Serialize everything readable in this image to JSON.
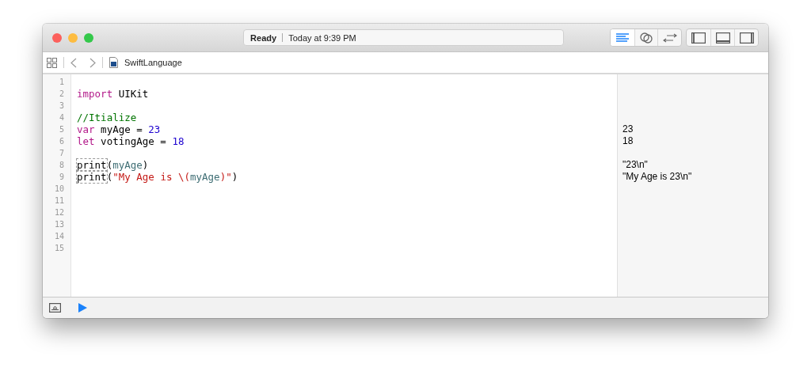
{
  "window": {
    "status": {
      "state": "Ready",
      "time": "Today at 9:39 PM"
    }
  },
  "toolbar": {
    "editor_buttons": [
      {
        "kind": "standard",
        "selected": true
      },
      {
        "kind": "assistant",
        "selected": false
      },
      {
        "kind": "version",
        "selected": false
      }
    ],
    "panel_buttons": [
      {
        "kind": "left",
        "selected": false
      },
      {
        "kind": "bottom",
        "selected": false
      },
      {
        "kind": "right",
        "selected": false
      }
    ]
  },
  "jump_bar": {
    "file": "SwiftLanguage"
  },
  "editor": {
    "lines": [
      {
        "number": "1"
      },
      {
        "number": "2",
        "tokens": [
          {
            "kind": "keyword",
            "text": "import"
          },
          {
            "kind": "plain",
            "text": " UIKit"
          }
        ]
      },
      {
        "number": "3"
      },
      {
        "number": "4",
        "tokens": [
          {
            "kind": "comment",
            "text": "//Itialize"
          }
        ]
      },
      {
        "number": "5",
        "tokens": [
          {
            "kind": "keyword",
            "text": "var"
          },
          {
            "kind": "plain",
            "text": " myAge = "
          },
          {
            "kind": "number",
            "text": "23"
          }
        ],
        "result": "23"
      },
      {
        "number": "6",
        "tokens": [
          {
            "kind": "keyword",
            "text": "let"
          },
          {
            "kind": "plain",
            "text": " votingAge = "
          },
          {
            "kind": "number",
            "text": "18"
          }
        ],
        "result": "18"
      },
      {
        "number": "7"
      },
      {
        "number": "8",
        "tokens": [
          {
            "kind": "marked",
            "text": "print"
          },
          {
            "kind": "plain",
            "text": "("
          },
          {
            "kind": "ident",
            "text": "myAge"
          },
          {
            "kind": "plain",
            "text": ")"
          }
        ],
        "result": "\"23\\n\""
      },
      {
        "number": "9",
        "tokens": [
          {
            "kind": "marked",
            "text": "print"
          },
          {
            "kind": "plain",
            "text": "("
          },
          {
            "kind": "string",
            "text": "\"My Age is \\("
          },
          {
            "kind": "ident",
            "text": "myAge"
          },
          {
            "kind": "string",
            "text": ")\""
          },
          {
            "kind": "plain",
            "text": ")"
          }
        ],
        "result": "\"My Age is 23\\n\""
      },
      {
        "number": "10"
      },
      {
        "number": "11"
      },
      {
        "number": "12"
      },
      {
        "number": "13"
      },
      {
        "number": "14"
      },
      {
        "number": "15"
      }
    ]
  }
}
